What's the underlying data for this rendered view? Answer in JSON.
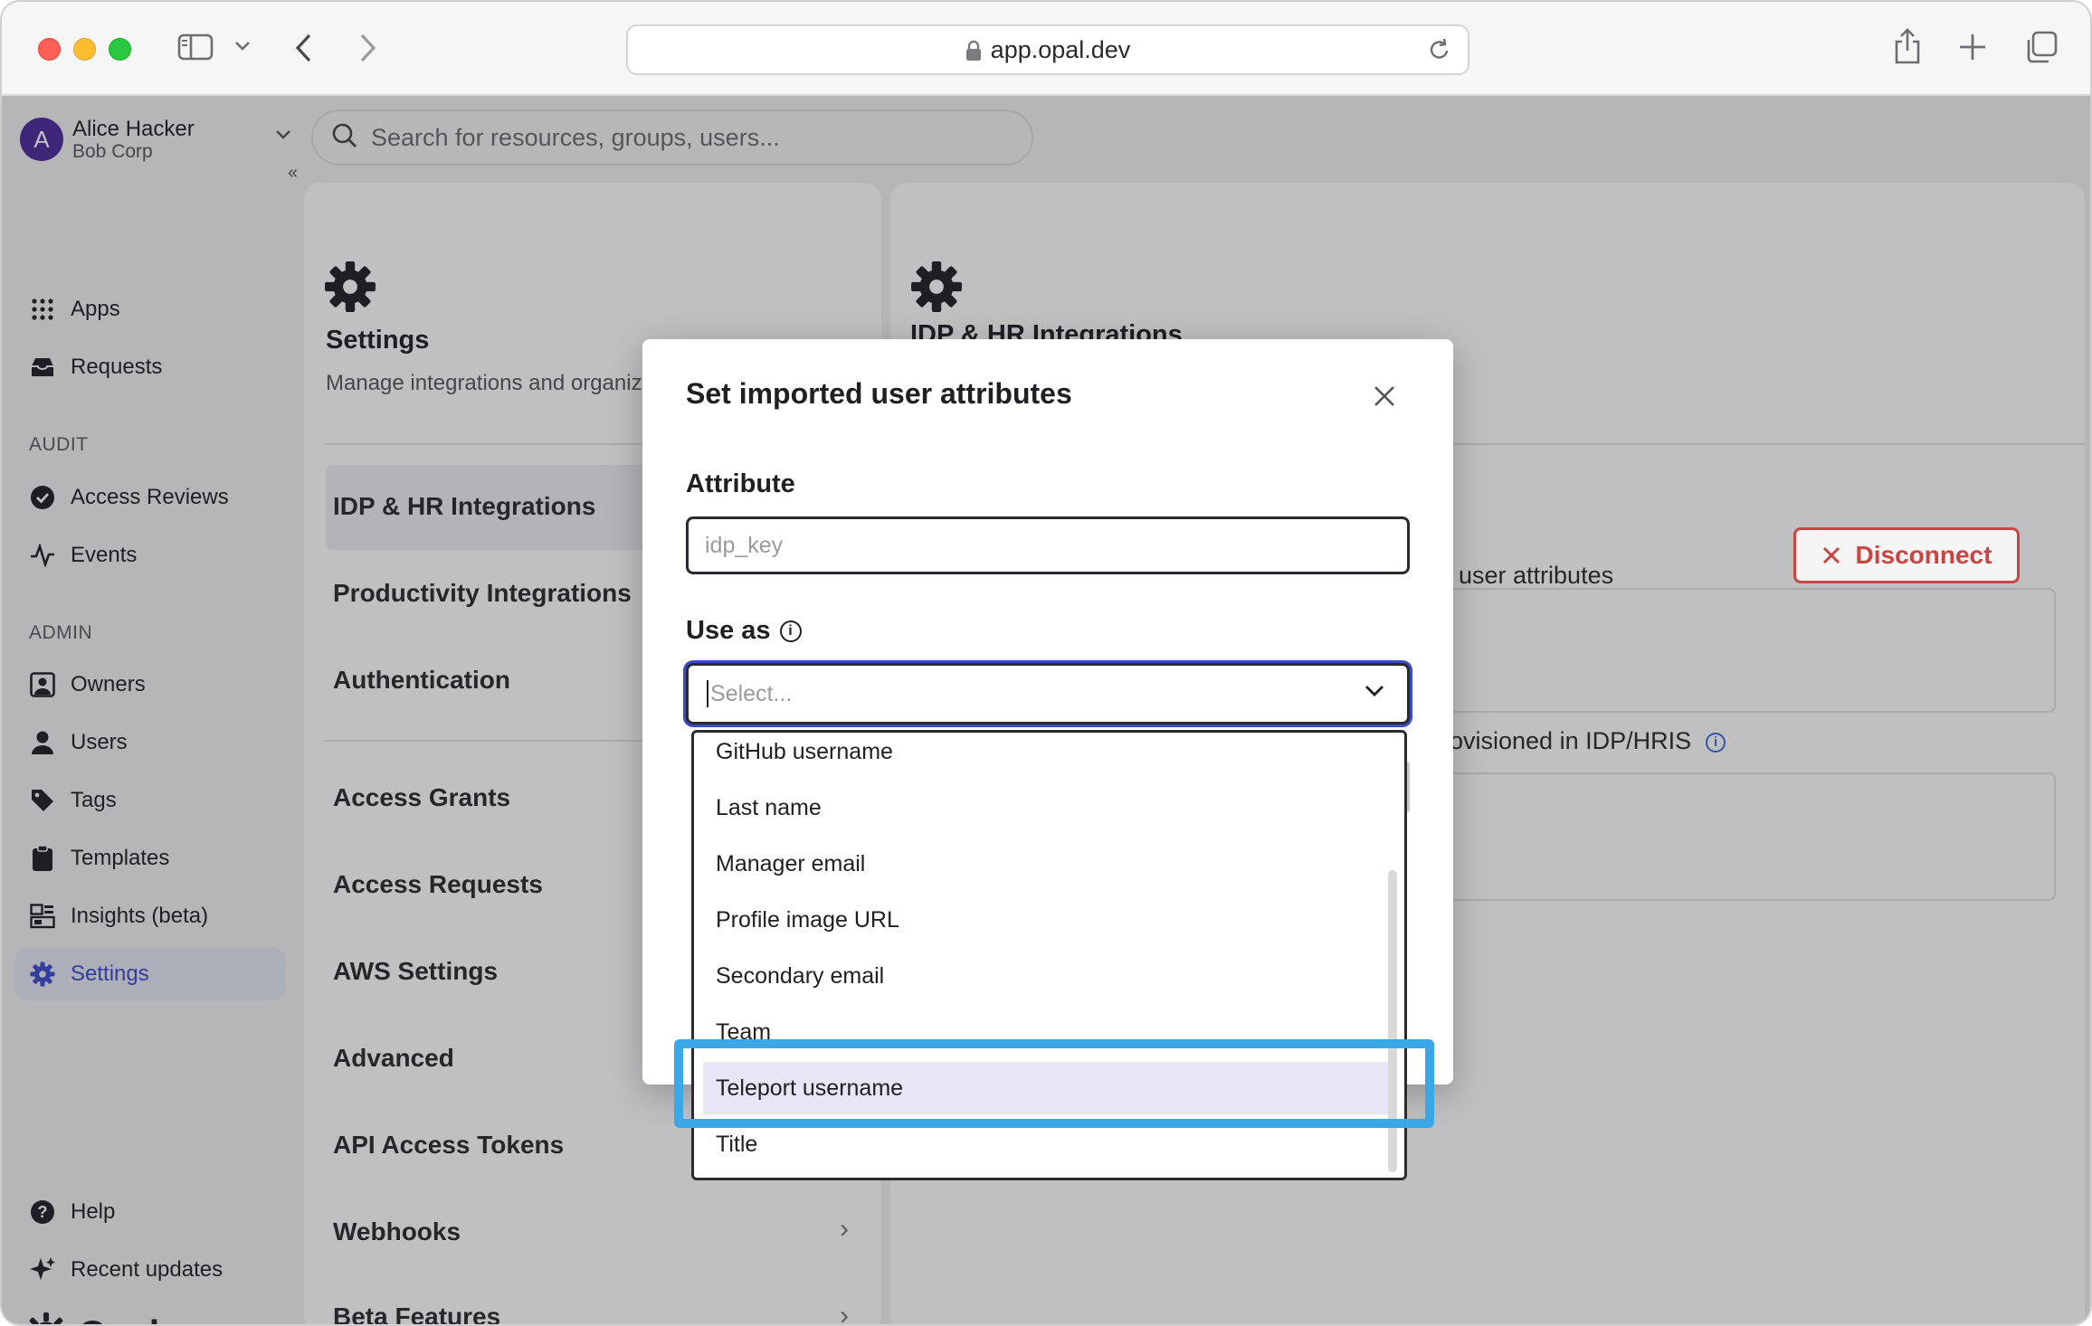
{
  "browser": {
    "url": "app.opal.dev"
  },
  "account": {
    "initial": "A",
    "name": "Alice Hacker",
    "org": "Bob Corp"
  },
  "search": {
    "placeholder": "Search for resources, groups, users..."
  },
  "sidebar": {
    "items_top": [
      {
        "label": "Apps",
        "icon": "grid-icon"
      },
      {
        "label": "Requests",
        "icon": "inbox-icon"
      }
    ],
    "audit_header": "AUDIT",
    "audit_items": [
      {
        "label": "Access Reviews",
        "icon": "check-circle-icon"
      },
      {
        "label": "Events",
        "icon": "activity-icon"
      }
    ],
    "admin_header": "ADMIN",
    "admin_items": [
      {
        "label": "Owners",
        "icon": "owner-icon"
      },
      {
        "label": "Users",
        "icon": "user-icon"
      },
      {
        "label": "Tags",
        "icon": "tag-icon"
      },
      {
        "label": "Templates",
        "icon": "clipboard-icon"
      },
      {
        "label": "Insights (beta)",
        "icon": "insights-icon"
      },
      {
        "label": "Settings",
        "icon": "gear-icon",
        "active": true
      }
    ],
    "bottom_items": [
      {
        "label": "Help",
        "icon": "help-icon"
      },
      {
        "label": "Recent updates",
        "icon": "sparkle-icon"
      }
    ],
    "brand": "Opal"
  },
  "settings": {
    "title": "Settings",
    "subtitle": "Manage integrations and organiza",
    "menu": [
      "IDP & HR Integrations",
      "Productivity Integrations",
      "Authentication",
      "Access Grants",
      "Access Requests",
      "AWS Settings",
      "Advanced",
      "API Access Tokens",
      "Webhooks",
      "Beta Features"
    ]
  },
  "right_panel": {
    "title": "IDP & HR Integrations",
    "card1_text": "user attributes",
    "disconnect_label": "Disconnect",
    "card2_text": "ovisioned in IDP/HRIS"
  },
  "modal": {
    "title": "Set imported user attributes",
    "attribute_label": "Attribute",
    "attribute_placeholder": "idp_key",
    "use_as_label": "Use as",
    "select_placeholder": "Select...",
    "options": [
      "GitHub username",
      "Last name",
      "Manager email",
      "Profile image URL",
      "Secondary email",
      "Team",
      "Teleport username",
      "Title"
    ],
    "highlighted_option": "Teleport username"
  },
  "colors": {
    "accent": "#3b4bc8",
    "danger": "#c9302c",
    "annotation": "#3aa7e6",
    "brand_avatar": "#4b2b9a"
  }
}
